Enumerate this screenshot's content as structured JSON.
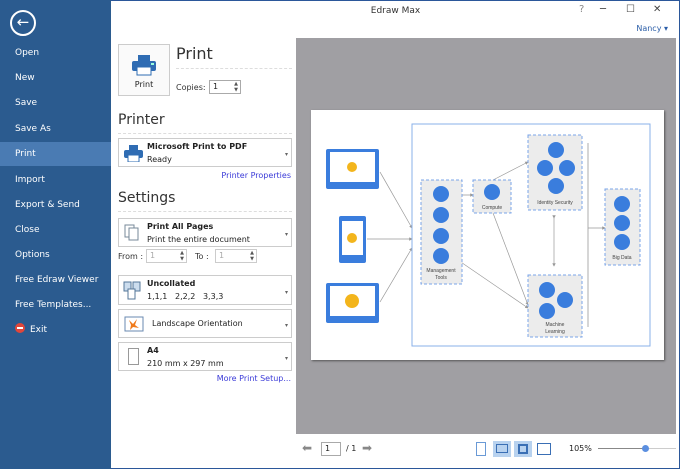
{
  "window": {
    "title": "Edraw Max",
    "user": "Nancy",
    "minimize": "─",
    "maximize": "☐",
    "close": "✕",
    "help": "?"
  },
  "sidebar": {
    "back_icon": "←",
    "items": [
      {
        "label": "Open"
      },
      {
        "label": "New"
      },
      {
        "label": "Save"
      },
      {
        "label": "Save As"
      },
      {
        "label": "Print"
      },
      {
        "label": "Import"
      },
      {
        "label": "Export & Send"
      },
      {
        "label": "Close"
      },
      {
        "label": "Options"
      },
      {
        "label": "Free Edraw Viewer"
      },
      {
        "label": "Free Templates..."
      },
      {
        "label": "Exit"
      }
    ]
  },
  "print": {
    "heading": "Print",
    "button_label": "Print",
    "copies_label": "Copies:",
    "copies_value": "1"
  },
  "printer": {
    "heading": "Printer",
    "name": "Microsoft Print to PDF",
    "status": "Ready",
    "properties_link": "Printer Properties"
  },
  "settings": {
    "heading": "Settings",
    "pages": {
      "title": "Print All Pages",
      "subtitle": "Print the entire document"
    },
    "from_label": "From :",
    "from_value": "1",
    "to_label": "To :",
    "to_value": "1",
    "collate": {
      "title": "Uncollated",
      "subtitle": "1,1,1   2,2,2   3,3,3"
    },
    "orientation": "Landscape Orientation",
    "paper": {
      "title": "A4",
      "subtitle": "210 mm x 297 mm"
    },
    "more_link": "More Print Setup..."
  },
  "diagram": {
    "management": "Management",
    "tools": "Tools",
    "compute": "Compute",
    "identity": "Identity Security",
    "machine": "Machine",
    "learning": "Learning",
    "bigdata": "Big Data"
  },
  "footer": {
    "page_value": "1",
    "page_total": "/ 1",
    "zoom": "105%",
    "zoom_fraction": 0.6
  }
}
